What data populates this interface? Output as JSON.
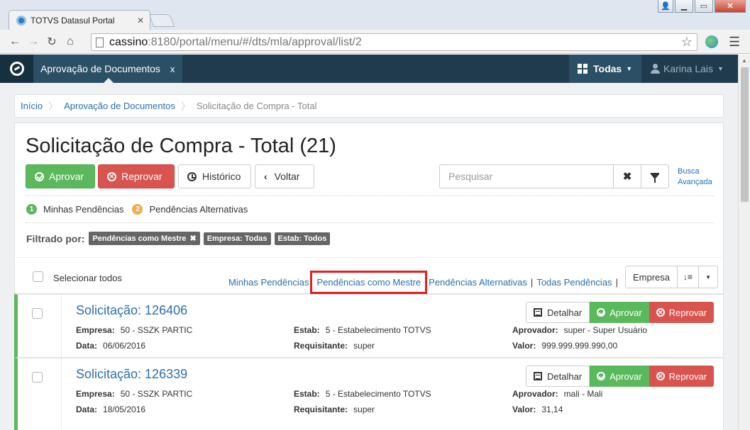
{
  "browser": {
    "tab_title": "TOTVS Datasul Portal",
    "url_host": "cassino",
    "url_rest": ":8180/portal/menu/#/dts/mla/approval/list/2"
  },
  "appbar": {
    "tab_label": "Aprovação de Documentos",
    "tab_close": "x",
    "todas_label": "Todas",
    "user_name": "Karina Lais"
  },
  "breadcrumb": [
    "Início",
    "Aprovação de Documentos",
    "Solicitação de Compra - Total"
  ],
  "page": {
    "title": "Solicitação de Compra - Total (21)",
    "approve_label": "Aprovar",
    "reject_label": "Reprovar",
    "history_label": "Histórico",
    "back_label": "Voltar",
    "search_placeholder": "Pesquisar",
    "advanced_search_label": "Busca Avançada"
  },
  "legend": {
    "one_num": "1",
    "one_label": "Minhas Pendências",
    "two_num": "2",
    "two_label": "Pendências Alternativas"
  },
  "filters": {
    "label": "Filtrado por:",
    "chips": [
      "Pendências como Mestre",
      "Empresa: Todas",
      "Estab: Todos"
    ],
    "chip_remove": "✖"
  },
  "list_header": {
    "select_all_label": "Selecionar todos",
    "views": [
      "Minhas Pendências",
      "Pendências como Mestre",
      "Pendências Alternativas",
      "Todas Pendências"
    ],
    "view_sep": "|",
    "sort_field": "Empresa"
  },
  "items": [
    {
      "title": "Solicitação: 126406",
      "empresa_label": "Empresa:",
      "empresa": "50 - SSZK PARTIC",
      "data_label": "Data:",
      "data": "06/06/2016",
      "estab_label": "Estab:",
      "estab": "5 - Estabelecimento TOTVS",
      "requisitante_label": "Requisitante:",
      "requisitante": "super",
      "aprovador_label": "Aprovador:",
      "aprovador": "super - Super Usuário",
      "valor_label": "Valor:",
      "valor": "999.999.999.990,00",
      "detail_label": "Detalhar",
      "approve_label": "Aprovar",
      "reject_label": "Reprovar"
    },
    {
      "title": "Solicitação: 126339",
      "empresa_label": "Empresa:",
      "empresa": "50 - SSZK PARTIC",
      "data_label": "Data:",
      "data": "18/05/2016",
      "estab_label": "Estab:",
      "estab": "5 - Estabelecimento TOTVS",
      "requisitante_label": "Requisitante:",
      "requisitante": "super",
      "aprovador_label": "Aprovador:",
      "aprovador": "mali - Mali",
      "valor_label": "Valor:",
      "valor": "31,14",
      "detail_label": "Detalhar",
      "approve_label": "Aprovar",
      "reject_label": "Reprovar"
    }
  ],
  "colors": {
    "app_header": "#1f3b4d",
    "primary_link": "#2a6fae",
    "success": "#5cb85c",
    "danger": "#d9534f",
    "highlight_box": "#e02020"
  }
}
